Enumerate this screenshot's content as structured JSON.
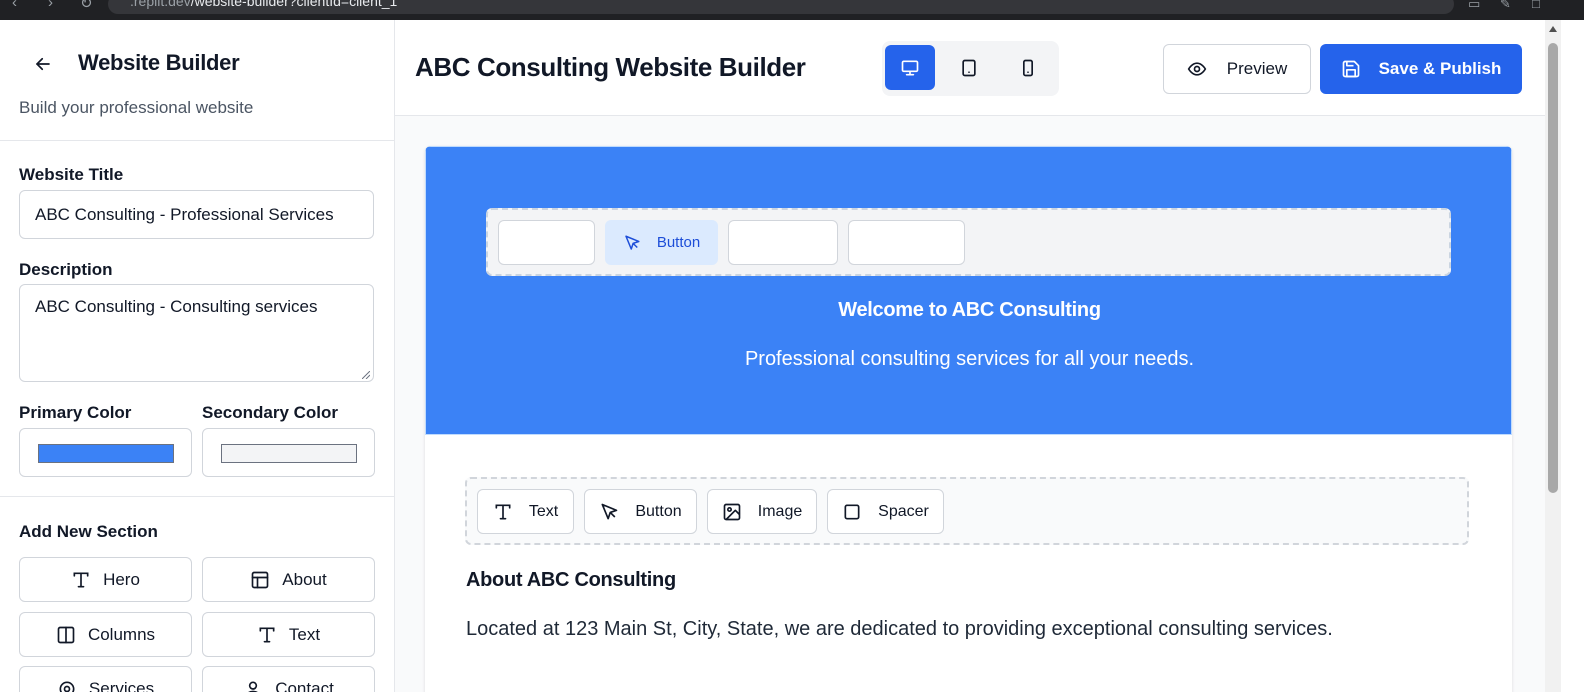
{
  "browser": {
    "url_host": ".replit.dev",
    "url_path": "/website-builder?clientId=client_1"
  },
  "sidebar": {
    "title": "Website Builder",
    "subtitle": "Build your professional website",
    "website_title_label": "Website Title",
    "website_title_value": "ABC Consulting - Professional Services",
    "description_label": "Description",
    "description_value": "ABC Consulting - Consulting services",
    "primary_color_label": "Primary Color",
    "primary_color_value": "#3b82f6",
    "secondary_color_label": "Secondary Color",
    "secondary_color_value": "#f3f4f6",
    "add_section_title": "Add New Section",
    "sections": [
      {
        "label": "Hero",
        "icon": "type-icon"
      },
      {
        "label": "About",
        "icon": "layout-icon"
      },
      {
        "label": "Columns",
        "icon": "columns-icon"
      },
      {
        "label": "Text",
        "icon": "type-icon"
      },
      {
        "label": "Services",
        "icon": "settings-icon"
      },
      {
        "label": "Contact",
        "icon": "user-icon"
      }
    ]
  },
  "header": {
    "page_title": "ABC Consulting Website Builder",
    "preview_label": "Preview",
    "publish_label": "Save & Publish",
    "devices": [
      "desktop-icon",
      "tablet-icon",
      "mobile-icon"
    ],
    "active_device": "desktop"
  },
  "canvas": {
    "hero": {
      "toolbar_button_label": "Button",
      "title": "Welcome to ABC Consulting",
      "subtitle": "Professional consulting services for all your needs."
    },
    "about": {
      "toolbar": [
        "Text",
        "Button",
        "Image",
        "Spacer"
      ],
      "title": "About ABC Consulting",
      "text": "Located at 123 Main St, City, State, we are dedicated to providing exceptional consulting services."
    }
  },
  "colors": {
    "accent": "#2563eb",
    "hero_bg": "#3b82f6"
  }
}
